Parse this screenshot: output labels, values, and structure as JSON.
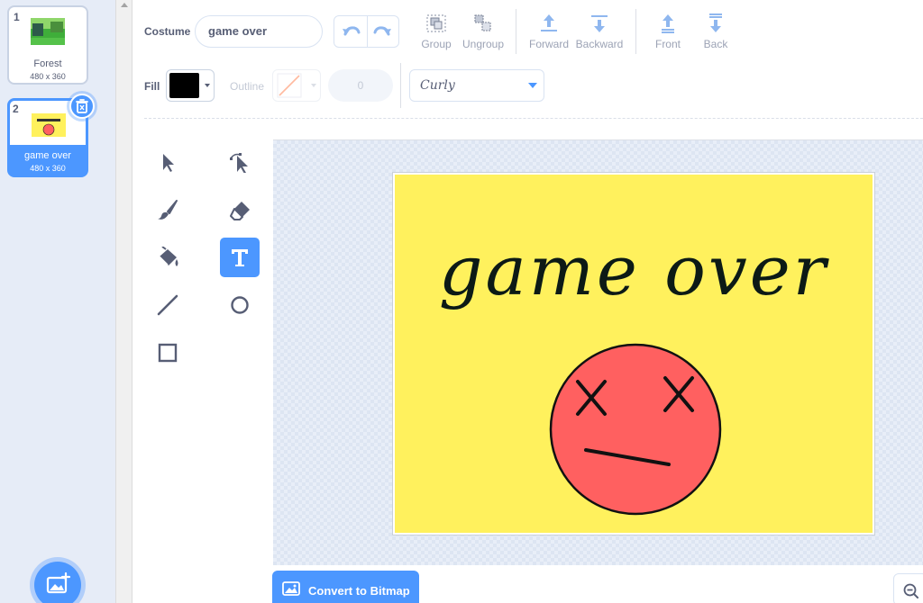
{
  "costumes": [
    {
      "number": "1",
      "name": "Forest",
      "size": "480 x 360",
      "selected": false
    },
    {
      "number": "2",
      "name": "game over",
      "size": "480 x 360",
      "selected": true
    }
  ],
  "toolbar": {
    "costume_label": "Costume",
    "costume_name": "game over",
    "group_label": "Group",
    "ungroup_label": "Ungroup",
    "forward_label": "Forward",
    "backward_label": "Backward",
    "front_label": "Front",
    "back_label": "Back",
    "fill_label": "Fill",
    "outline_label": "Outline",
    "outline_width": "0",
    "font": "Curly"
  },
  "colors": {
    "accent": "#4c97ff",
    "fill_color": "#000000",
    "artboard_bg": "#fff15d",
    "face_color": "#ff6060"
  },
  "tools": [
    {
      "name": "select",
      "icon": "arrow-pointer-icon"
    },
    {
      "name": "reshape",
      "icon": "reshape-pointer-icon"
    },
    {
      "name": "brush",
      "icon": "brush-icon"
    },
    {
      "name": "eraser",
      "icon": "eraser-icon"
    },
    {
      "name": "fill",
      "icon": "paint-bucket-icon"
    },
    {
      "name": "text",
      "icon": "text-icon",
      "active": true
    },
    {
      "name": "line",
      "icon": "line-icon"
    },
    {
      "name": "circle",
      "icon": "circle-icon"
    },
    {
      "name": "rectangle",
      "icon": "rectangle-icon"
    }
  ],
  "canvas": {
    "text": "game over"
  },
  "bottom": {
    "convert_label": "Convert to Bitmap"
  }
}
